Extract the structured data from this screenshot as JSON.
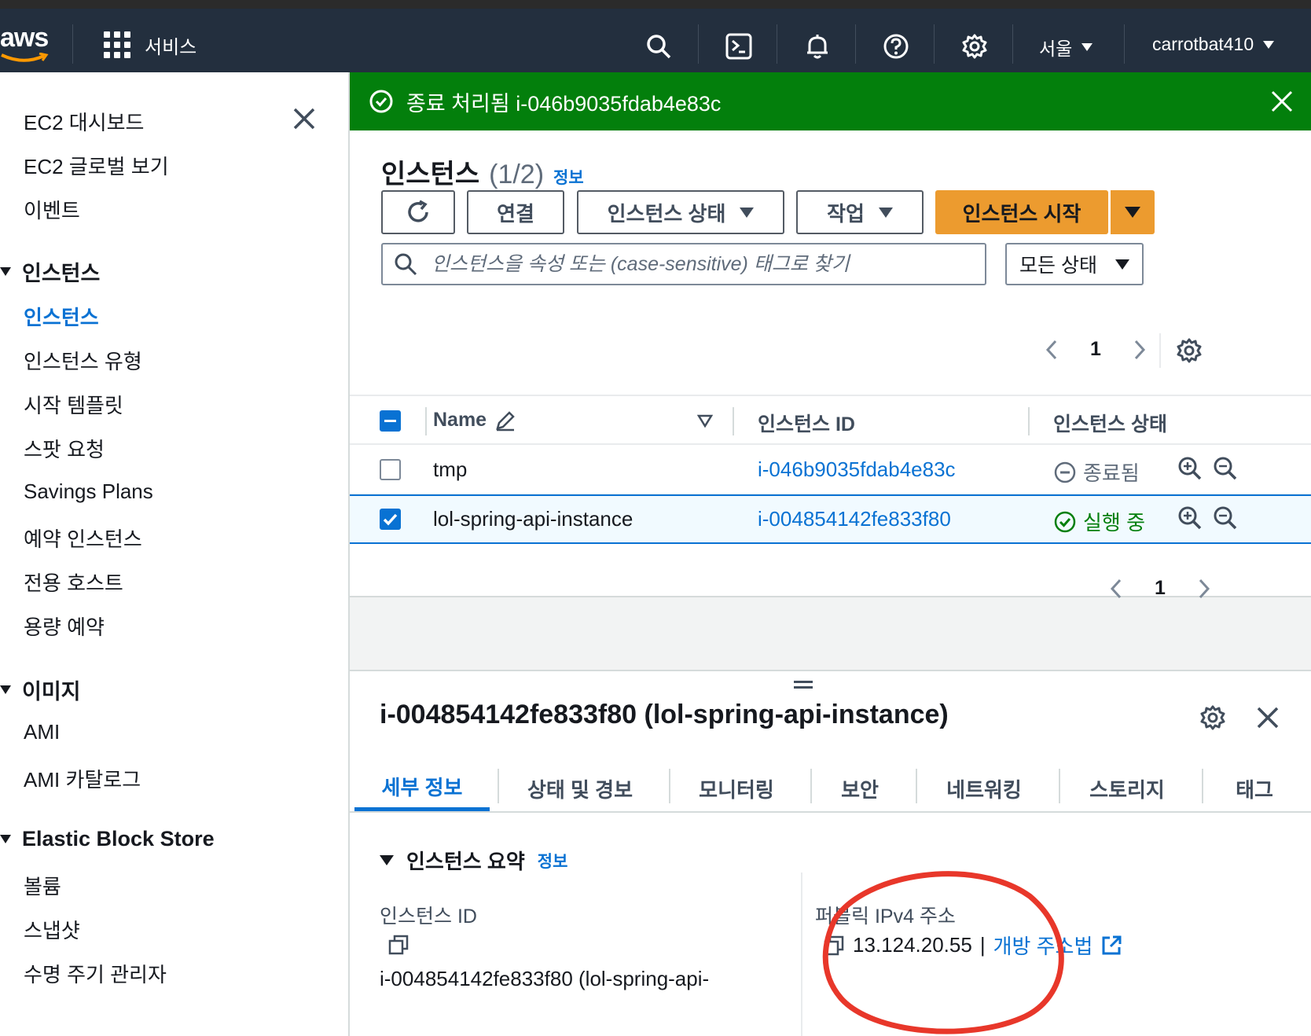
{
  "topnav": {
    "logo": "aws",
    "services_label": "서비스",
    "region": "서울",
    "account": "carrotbat410"
  },
  "sidebar": {
    "top_items": [
      "EC2 대시보드",
      "EC2 글로벌 보기",
      "이벤트"
    ],
    "sections": [
      {
        "title": "인스턴스",
        "items": [
          "인스턴스",
          "인스턴스 유형",
          "시작 템플릿",
          "스팟 요청",
          "Savings Plans",
          "예약 인스턴스",
          "전용 호스트",
          "용량 예약"
        ]
      },
      {
        "title": "이미지",
        "items": [
          "AMI",
          "AMI 카탈로그"
        ]
      },
      {
        "title": "Elastic Block Store",
        "items": [
          "볼륨",
          "스냅샷",
          "수명 주기 관리자"
        ]
      }
    ],
    "active_item": "인스턴스"
  },
  "flash": {
    "message": "종료 처리됨 i-046b9035fdab4e83c"
  },
  "instances": {
    "title": "인스턴스",
    "count": "(1/2)",
    "info": "정보",
    "buttons": {
      "connect": "연결",
      "instance_state": "인스턴스 상태",
      "actions": "작업",
      "launch": "인스턴스 시작"
    },
    "search_placeholder": "인스턴스을 속성 또는 (case-sensitive) 태그로 찾기",
    "state_filter": "모든 상태",
    "page": "1",
    "columns": [
      "Name",
      "인스턴스 ID",
      "인스턴스 상태"
    ],
    "rows": [
      {
        "name": "tmp",
        "id": "i-046b9035fdab4e83c",
        "state": "종료됨",
        "selected": false
      },
      {
        "name": "lol-spring-api-instance",
        "id": "i-004854142fe833f80",
        "state": "실행 중",
        "selected": true
      }
    ],
    "bottom_page": "1"
  },
  "details": {
    "title": "i-004854142fe833f80 (lol-spring-api-instance)",
    "tabs": [
      "세부 정보",
      "상태 및 경보",
      "모니터링",
      "보안",
      "네트워킹",
      "스토리지",
      "태그"
    ],
    "active_tab": "세부 정보",
    "summary_title": "인스턴스 요약",
    "summary_info": "정보",
    "instance_id_label": "인스턴스 ID",
    "instance_id_value": "i-004854142fe833f80 (lol-spring-api-",
    "public_ipv4_label": "퍼블릭 IPv4 주소",
    "public_ipv4_value": "13.124.20.55",
    "public_ipv4_sep": "|",
    "open_address_link": "개방 주소법"
  },
  "colors": {
    "nav_bg": "#232f3e",
    "success_green": "#037f0c",
    "primary_orange": "#ec9b2f",
    "link_blue": "#0972d3",
    "annotation_red": "#e8372a"
  }
}
